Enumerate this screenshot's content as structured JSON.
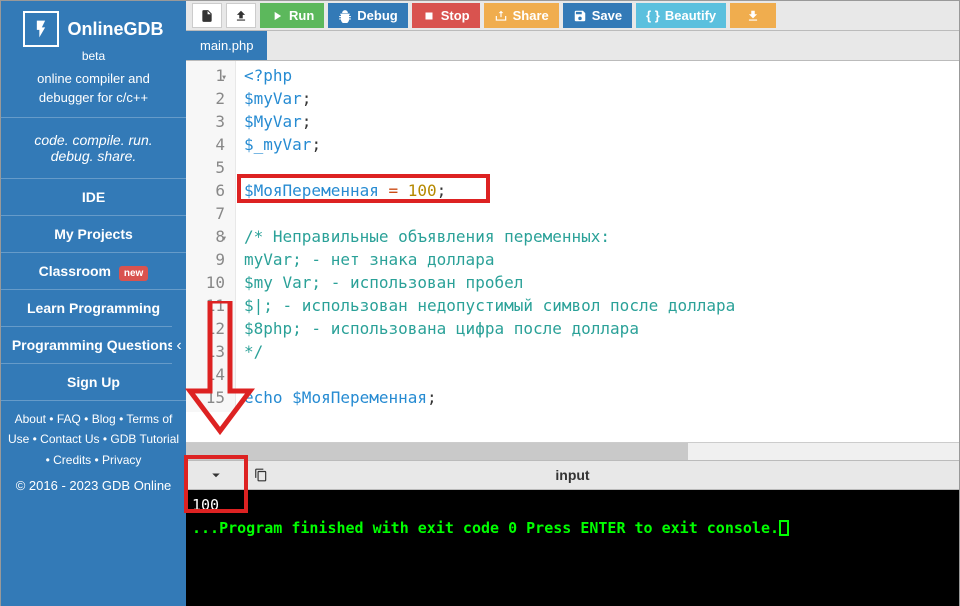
{
  "brand": {
    "name": "OnlineGDB",
    "beta": "beta",
    "tag1a": "online compiler and",
    "tag1b": "debugger for c/c++",
    "slogan1": "code. compile. run.",
    "slogan2": "debug. share."
  },
  "nav": {
    "ide": "IDE",
    "projects": "My Projects",
    "classroom": "Classroom",
    "classroom_badge": "new",
    "learn": "Learn Programming",
    "questions": "Programming Questions",
    "signup": "Sign Up"
  },
  "footer_links": "About • FAQ • Blog • Terms of Use • Contact Us • GDB Tutorial • Credits • Privacy",
  "copyright": "© 2016 - 2023 GDB Online",
  "toolbar": {
    "run": "Run",
    "debug": "Debug",
    "stop": "Stop",
    "share": "Share",
    "save": "Save",
    "beautify": "Beautify"
  },
  "tabs": {
    "active": "main.php"
  },
  "code": {
    "lines": [
      "1",
      "2",
      "3",
      "4",
      "5",
      "6",
      "7",
      "8",
      "9",
      "10",
      "11",
      "12",
      "13",
      "14",
      "15"
    ],
    "l1": "<?php",
    "l2": "$myVar",
    "l3": "$MyVar",
    "l4": "$_myVar",
    "l6_var": "$МояПеременная",
    "l6_eq": " = ",
    "l6_val": "100",
    "l8": "/* Неправильные объявления переменных:",
    "l9": "myVar; - нет знака доллара",
    "l10": "$my Var; - использован пробел",
    "l11": "$|; - использован недопустимый символ после доллара",
    "l12": "$8php; - использована цифра после доллара",
    "l13": "*/",
    "l15_echo": "echo ",
    "l15_var": "$МояПеременная"
  },
  "console": {
    "input_label": "input",
    "output_value": "100",
    "line1": "...Program finished with exit code 0",
    "line2": "Press ENTER to exit console."
  }
}
